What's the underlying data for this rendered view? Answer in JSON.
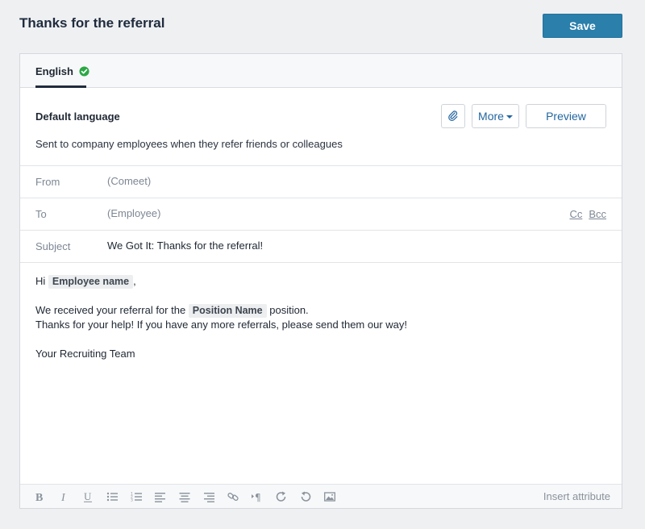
{
  "header": {
    "title": "Thanks for the referral",
    "save_label": "Save"
  },
  "tabs": [
    {
      "label": "English",
      "status_icon": "check-circle-icon",
      "status_color": "#2aa845",
      "active": true
    }
  ],
  "language": {
    "title": "Default language",
    "description": "Sent to company employees when they refer friends or colleagues",
    "attach_icon": "paperclip-icon",
    "more_label": "More",
    "preview_label": "Preview"
  },
  "fields": {
    "from": {
      "label": "From",
      "value": "(Comeet)"
    },
    "to": {
      "label": "To",
      "value": "(Employee)",
      "cc": "Cc",
      "bcc": "Bcc"
    },
    "subject": {
      "label": "Subject",
      "value": "We Got It: Thanks for the referral!"
    }
  },
  "body": {
    "greeting_prefix": "Hi",
    "greeting_token": "Employee name",
    "greeting_suffix": ",",
    "line1_prefix": "We received your referral for the",
    "line1_token": "Position Name",
    "line1_suffix": "position.",
    "line2": "Thanks for your help! If you have any more referrals, please send them our way!",
    "signature": "Your Recruiting Team"
  },
  "toolbar": {
    "tools": [
      "bold-icon",
      "italic-icon",
      "underline-icon",
      "bullet-list-icon",
      "numbered-list-icon",
      "align-left-icon",
      "align-center-icon",
      "align-right-icon",
      "link-icon",
      "text-direction-icon",
      "redo-icon",
      "undo-icon",
      "image-icon"
    ],
    "insert_attribute_label": "Insert attribute"
  },
  "colors": {
    "accent": "#2a7fab",
    "link": "#2366a0",
    "success": "#2aa845"
  }
}
